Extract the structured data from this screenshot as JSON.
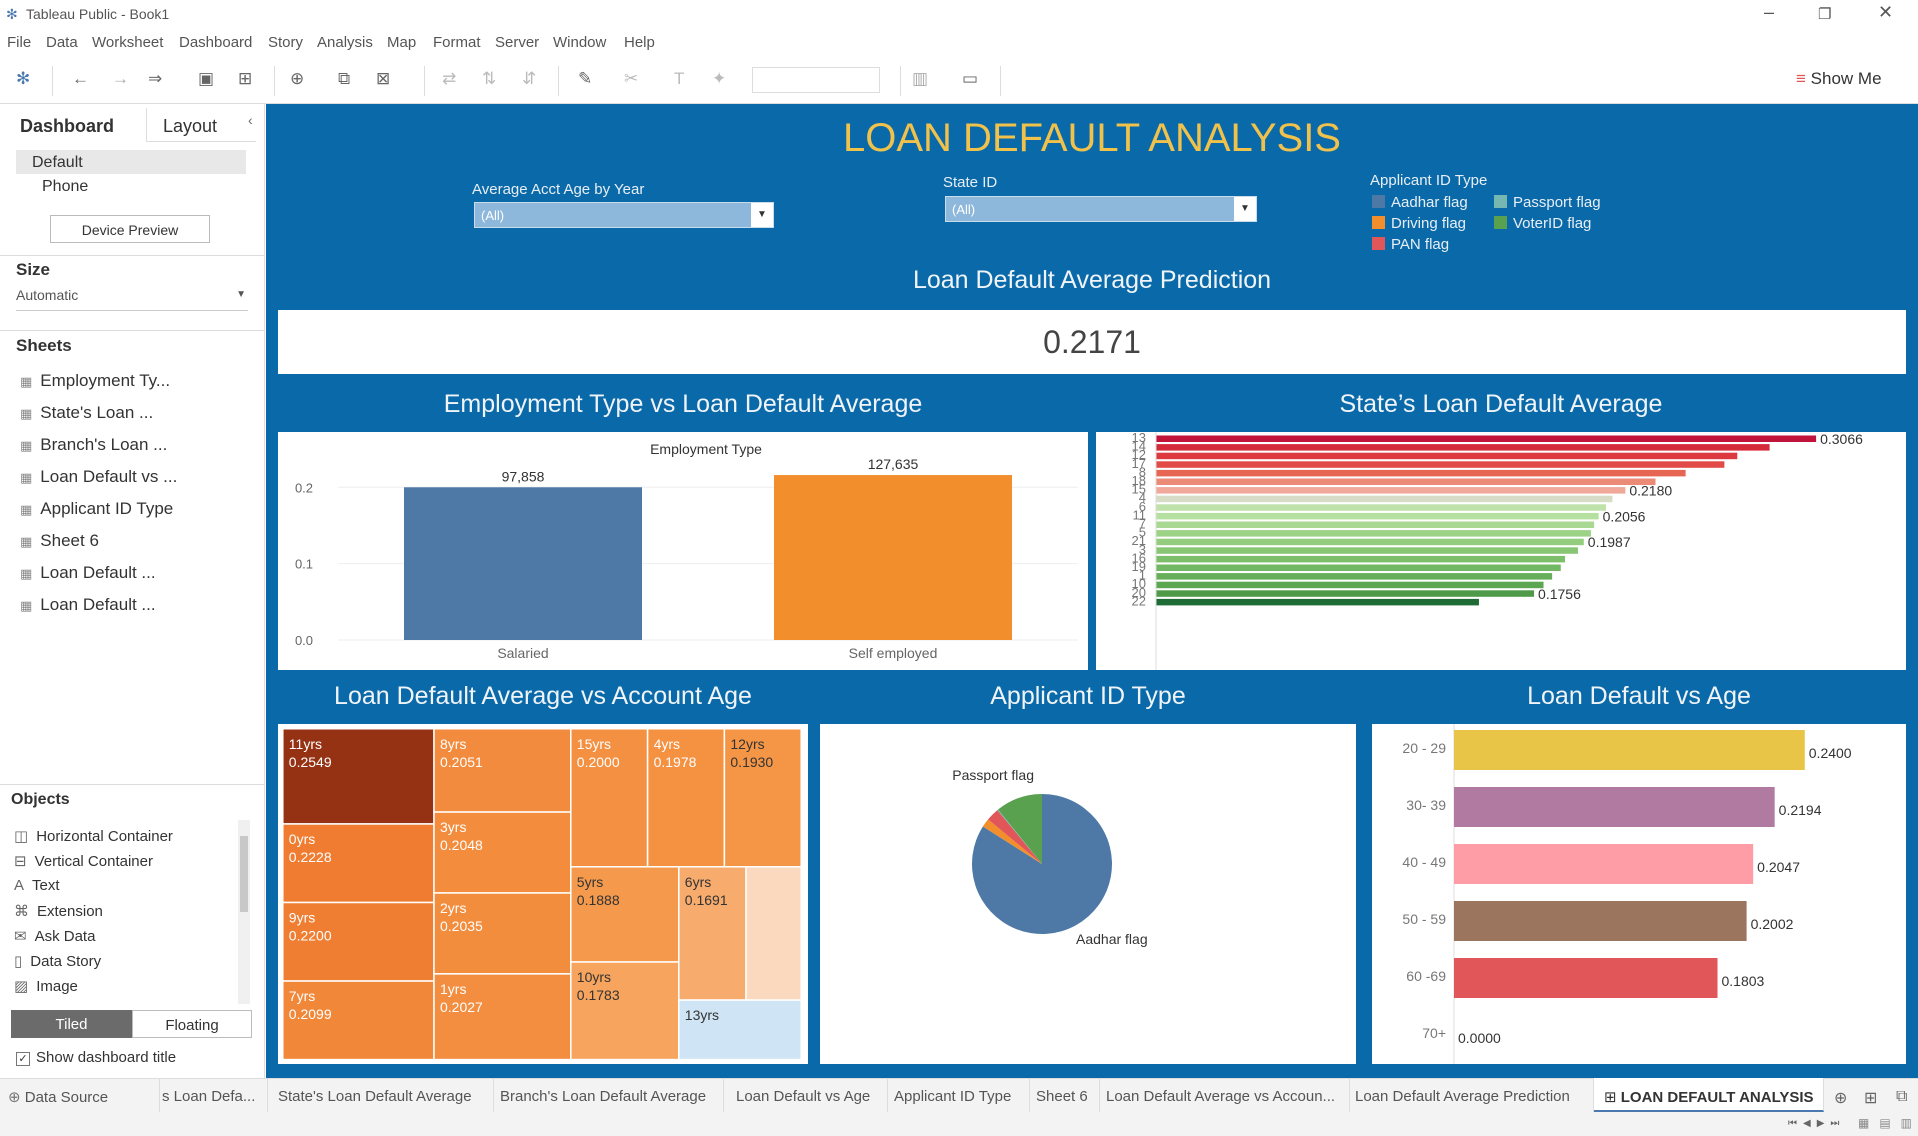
{
  "app": {
    "window_title": "Tableau Public - Book1",
    "menu": [
      "File",
      "Data",
      "Worksheet",
      "Dashboard",
      "Story",
      "Analysis",
      "Map",
      "Format",
      "Server",
      "Window",
      "Help"
    ],
    "show_me_label": "Show Me"
  },
  "left_panel": {
    "tabs": [
      "Dashboard",
      "Layout"
    ],
    "devices": [
      "Default",
      "Phone"
    ],
    "device_preview_label": "Device Preview",
    "size_header": "Size",
    "size_value": "Automatic",
    "sheets_header": "Sheets",
    "sheets": [
      "Employment Ty...",
      "State's Loan ...",
      "Branch's Loan ...",
      "Loan Default vs ...",
      "Applicant ID Type",
      "Sheet 6",
      "Loan Default ...",
      "Loan Default ..."
    ],
    "objects_header": "Objects",
    "objects": [
      "Horizontal Container",
      "Vertical Container",
      "Text",
      "Extension",
      "Ask Data",
      "Data Story",
      "Image"
    ],
    "layout_modes": [
      "Tiled",
      "Floating"
    ],
    "show_title_label": "Show dashboard title"
  },
  "dashboard": {
    "title": "LOAN DEFAULT ANALYSIS",
    "filters": [
      {
        "label": "Average Acct Age by Year",
        "value": "(All)"
      },
      {
        "label": "State ID",
        "value": "(All)"
      }
    ],
    "legend": {
      "title": "Applicant ID Type",
      "items": [
        {
          "name": "Aadhar flag",
          "color": "#4e79a7"
        },
        {
          "name": "Passport flag",
          "color": "#76b7b2"
        },
        {
          "name": "Driving flag",
          "color": "#f28e2b"
        },
        {
          "name": "VoterID flag",
          "color": "#59a14f"
        },
        {
          "name": "PAN flag",
          "color": "#e15759"
        }
      ]
    },
    "prediction": {
      "title": "Loan Default Average Prediction",
      "value": "0.2171"
    },
    "employment": {
      "title": "Employment Type vs Loan Default Average",
      "header": "Employment Type"
    },
    "state": {
      "title": "State’s Loan Default Average"
    },
    "account_age": {
      "title": "Loan Default Average vs Account Age"
    },
    "applicant": {
      "title": "Applicant ID Type"
    },
    "age": {
      "title": "Loan Default vs Age"
    }
  },
  "chart_data": [
    {
      "type": "bar",
      "title": "Employment Type vs Loan Default Average",
      "xlabel": "Employment Type",
      "categories": [
        "Salaried",
        "Self employed"
      ],
      "values": [
        0.2,
        0.216
      ],
      "data_labels": [
        "97,858",
        "127,635"
      ],
      "colors": [
        "#4e79a7",
        "#f28e2b"
      ],
      "yticks": [
        "0.0",
        "0.1",
        "0.2"
      ],
      "ylim": [
        0,
        0.22
      ]
    },
    {
      "type": "bar",
      "title": "State’s Loan Default Average",
      "orientation": "horizontal",
      "categories": [
        "13",
        "14",
        "12",
        "17",
        "8",
        "18",
        "15",
        "4",
        "6",
        "11",
        "7",
        "5",
        "21",
        "3",
        "16",
        "19",
        "1",
        "10",
        "20",
        "22"
      ],
      "values": [
        0.3066,
        0.285,
        0.27,
        0.264,
        0.246,
        0.232,
        0.218,
        0.212,
        0.209,
        0.2056,
        0.2035,
        0.202,
        0.1987,
        0.196,
        0.19,
        0.188,
        0.184,
        0.18,
        0.1756,
        0.15
      ],
      "data_labels": {
        "0": "0.3066",
        "6": "0.2180",
        "9": "0.2056",
        "12": "0.1987",
        "18": "0.1756"
      },
      "xlim": [
        0,
        0.34
      ]
    },
    {
      "type": "heatmap",
      "subtype": "treemap",
      "title": "Loan Default Average vs Account Age",
      "items": [
        {
          "label": "11yrs",
          "value": "0.2549",
          "v": 0.2549
        },
        {
          "label": "0yrs",
          "value": "0.2228",
          "v": 0.2228
        },
        {
          "label": "9yrs",
          "value": "0.2200",
          "v": 0.22
        },
        {
          "label": "7yrs",
          "value": "0.2099",
          "v": 0.2099
        },
        {
          "label": "8yrs",
          "value": "0.2051",
          "v": 0.2051
        },
        {
          "label": "3yrs",
          "value": "0.2048",
          "v": 0.2048
        },
        {
          "label": "2yrs",
          "value": "0.2035",
          "v": 0.2035
        },
        {
          "label": "1yrs",
          "value": "0.2027",
          "v": 0.2027
        },
        {
          "label": "15yrs",
          "value": "0.2000",
          "v": 0.2
        },
        {
          "label": "4yrs",
          "value": "0.1978",
          "v": 0.1978
        },
        {
          "label": "12yrs",
          "value": "0.1930",
          "v": 0.193
        },
        {
          "label": "5yrs",
          "value": "0.1888",
          "v": 0.1888
        },
        {
          "label": "10yrs",
          "value": "0.1783",
          "v": 0.1783
        },
        {
          "label": "6yrs",
          "value": "0.1691",
          "v": 0.1691
        },
        {
          "label": "",
          "value": "",
          "v": 0.12
        },
        {
          "label": "13yrs",
          "value": "",
          "v": 0
        }
      ]
    },
    {
      "type": "pie",
      "title": "Applicant ID Type",
      "slices": [
        {
          "name": "Aadhar flag",
          "value": 0.84,
          "color": "#4e79a7",
          "label": "Aadhar flag"
        },
        {
          "name": "Driving flag",
          "value": 0.02,
          "color": "#f28e2b",
          "label": ""
        },
        {
          "name": "PAN flag",
          "value": 0.03,
          "color": "#e15759",
          "label": ""
        },
        {
          "name": "Passport flag",
          "value": 0.002,
          "color": "#76b7b2",
          "label": "Passport flag"
        },
        {
          "name": "VoterID flag",
          "value": 0.108,
          "color": "#59a14f",
          "label": ""
        }
      ]
    },
    {
      "type": "bar",
      "title": "Loan Default vs Age",
      "orientation": "horizontal",
      "categories": [
        "20 - 29",
        "30- 39",
        "40 - 49",
        "50 - 59",
        "60 -69",
        "70+"
      ],
      "values": [
        0.24,
        0.2194,
        0.2047,
        0.2002,
        0.1803,
        0.0
      ],
      "data_labels": [
        "0.2400",
        "0.2194",
        "0.2047",
        "0.2002",
        "0.1803",
        "0.0000"
      ],
      "colors": [
        "#e8c547",
        "#b07aa1",
        "#ff9da7",
        "#9c755f",
        "#e15759",
        "#cccccc"
      ],
      "xlim": [
        0,
        0.26
      ]
    }
  ],
  "bottom_tabs": [
    "Data Source",
    "s Loan Defa...",
    "State's Loan Default Average",
    "Branch's Loan Default Average",
    "Loan Default vs Age",
    "Applicant ID Type",
    "Sheet 6",
    "Loan Default Average vs Accoun...",
    "Loan Default Average Prediction",
    "LOAN DEFAULT ANALYSIS"
  ]
}
